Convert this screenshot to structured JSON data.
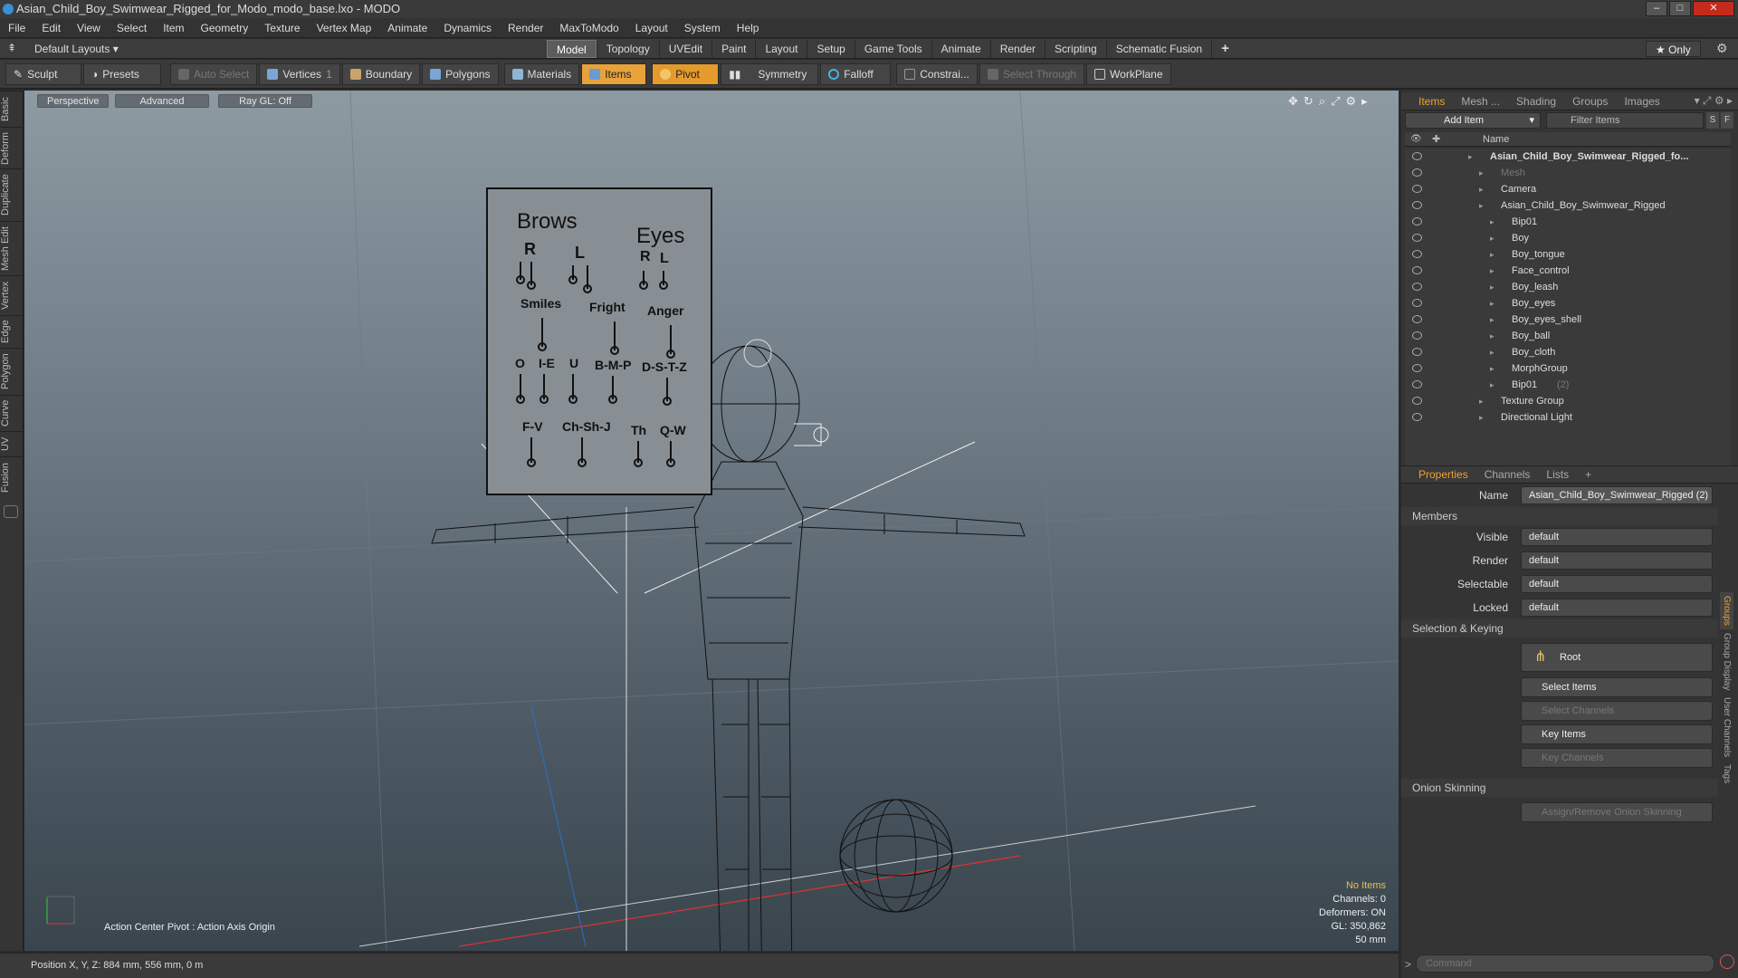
{
  "window": {
    "title": "Asian_Child_Boy_Swimwear_Rigged_for_Modo_modo_base.lxo - MODO",
    "min": "–",
    "max": "□",
    "close": "✕"
  },
  "menu": [
    "File",
    "Edit",
    "View",
    "Select",
    "Item",
    "Geometry",
    "Texture",
    "Vertex Map",
    "Animate",
    "Dynamics",
    "Render",
    "MaxToModo",
    "Layout",
    "System",
    "Help"
  ],
  "layout": {
    "preset": "Default Layouts ▾",
    "tabs": [
      "Model",
      "Topology",
      "UVEdit",
      "Paint",
      "Layout",
      "Setup",
      "Game Tools",
      "Animate",
      "Render",
      "Scripting",
      "Schematic Fusion"
    ],
    "active": "Model",
    "add": "+",
    "only": "★ Only"
  },
  "toolbar": {
    "sculpt": "Sculpt",
    "presets": "Presets",
    "auto_select": "Auto Select",
    "vertices": "Vertices",
    "vert_count": "1",
    "boundary": "Boundary",
    "polygons": "Polygons",
    "materials": "Materials",
    "items": "Items",
    "pivot": "Pivot",
    "symmetry": "Symmetry",
    "falloff": "Falloff",
    "constraints": "Constrai...",
    "select_through": "Select Through",
    "workplane": "WorkPlane"
  },
  "lefttabs": [
    "Basic",
    "Deform",
    "Duplicate",
    "Mesh Edit",
    "Vertex",
    "Edge",
    "Polygon",
    "Curve",
    "UV",
    "Fusion"
  ],
  "viewport": {
    "view": "Perspective",
    "style": "Advanced",
    "raygl": "Ray GL: Off",
    "action_center": "Action Center Pivot : Action Axis Origin",
    "info": {
      "no_items": "No Items",
      "channels": "Channels: 0",
      "deformers": "Deformers: ON",
      "gl": "GL: 350,862",
      "focal": "50 mm"
    }
  },
  "chart": {
    "brows": "Brows",
    "eyes": "Eyes",
    "r": "R",
    "l": "L",
    "r2": "R",
    "l2": "L",
    "smiles": "Smiles",
    "fright": "Fright",
    "anger": "Anger",
    "o": "O",
    "ie": "I-E",
    "u": "U",
    "bmp": "B-M-P",
    "dstz": "D-S-T-Z",
    "fv": "F-V",
    "chshj": "Ch-Sh-J",
    "th": "Th",
    "qw": "Q-W"
  },
  "status": {
    "position": "Position X, Y, Z:  884 mm, 556 mm, 0 m"
  },
  "items_panel": {
    "tabs": [
      "Items",
      "Mesh ...",
      "Shading",
      "Groups",
      "Images"
    ],
    "add_item": "Add Item",
    "filter": "Filter Items",
    "s": "S",
    "f": "F",
    "col_name": "Name",
    "tree": [
      {
        "name": "Asian_Child_Boy_Swimwear_Rigged_fo...",
        "indent": 0,
        "bold": true
      },
      {
        "name": "Mesh",
        "indent": 1,
        "dim": true
      },
      {
        "name": "Camera",
        "indent": 1
      },
      {
        "name": "Asian_Child_Boy_Swimwear_Rigged",
        "indent": 1
      },
      {
        "name": "Bip01",
        "indent": 2
      },
      {
        "name": "Boy",
        "indent": 2
      },
      {
        "name": "Boy_tongue",
        "indent": 2
      },
      {
        "name": "Face_control",
        "indent": 2
      },
      {
        "name": "Boy_leash",
        "indent": 2
      },
      {
        "name": "Boy_eyes",
        "indent": 2
      },
      {
        "name": "Boy_eyes_shell",
        "indent": 2
      },
      {
        "name": "Boy_ball",
        "indent": 2
      },
      {
        "name": "Boy_cloth",
        "indent": 2
      },
      {
        "name": "MorphGroup",
        "indent": 2
      },
      {
        "name": "Bip01",
        "suffix": "(2)",
        "indent": 2
      },
      {
        "name": "Texture Group",
        "indent": 1
      },
      {
        "name": "Directional Light",
        "indent": 1
      }
    ]
  },
  "props_panel": {
    "tabs": [
      "Properties",
      "Channels",
      "Lists",
      "+"
    ],
    "name_label": "Name",
    "name_value": "Asian_Child_Boy_Swimwear_Rigged (2)",
    "members": "Members",
    "visible": "Visible",
    "render": "Render",
    "selectable": "Selectable",
    "locked": "Locked",
    "default": "default",
    "sel_keying": "Selection & Keying",
    "root": "Root",
    "select_items": "Select Items",
    "select_channels": "Select Channels",
    "key_items": "Key Items",
    "key_channels": "Key Channels",
    "onion": "Onion Skinning",
    "assign_onion": "Assign/Remove Onion Skinning",
    "side_tabs": [
      "Groups",
      "Group Display",
      "User Channels",
      "Tags"
    ]
  },
  "command": {
    "placeholder": "Command",
    "prompt": ">"
  },
  "colors": {
    "accent": "#f0a030",
    "viewport_top": "#8e9aa2"
  }
}
